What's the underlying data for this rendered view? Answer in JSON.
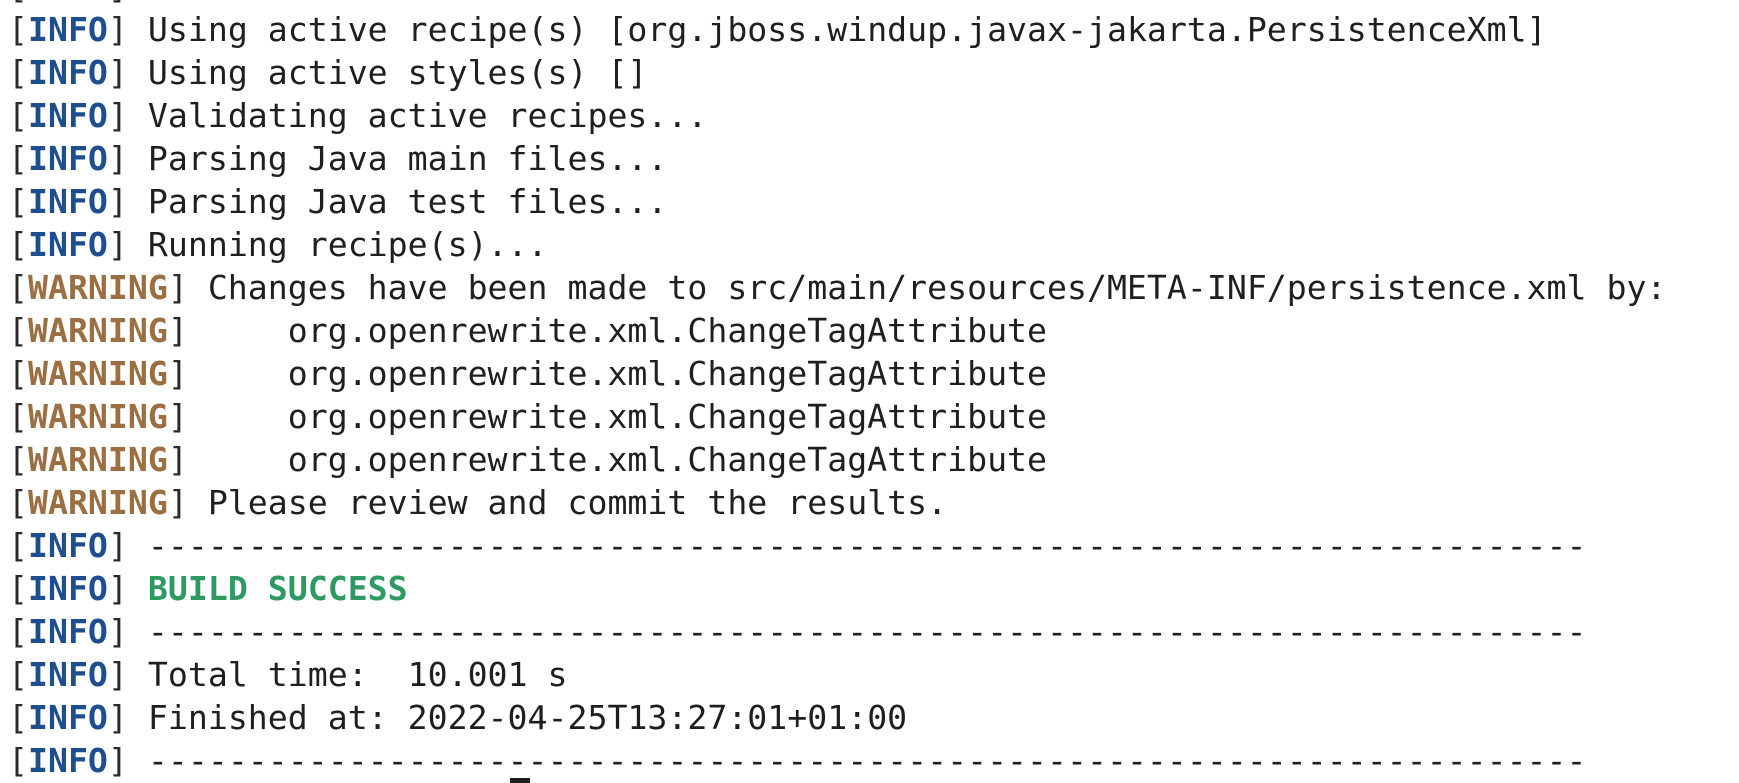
{
  "terminal": {
    "lines": [
      {
        "level": "INFO",
        "text": "Using active recipe(s) [org.jboss.windup.javax-jakarta.PersistenceXml]"
      },
      {
        "level": "INFO",
        "text": "Using active styles(s) []"
      },
      {
        "level": "INFO",
        "text": "Validating active recipes..."
      },
      {
        "level": "INFO",
        "text": "Parsing Java main files..."
      },
      {
        "level": "INFO",
        "text": "Parsing Java test files..."
      },
      {
        "level": "INFO",
        "text": "Running recipe(s)..."
      },
      {
        "level": "WARNING",
        "text": "Changes have been made to src/main/resources/META-INF/persistence.xml by:"
      },
      {
        "level": "WARNING",
        "text": "    org.openrewrite.xml.ChangeTagAttribute"
      },
      {
        "level": "WARNING",
        "text": "    org.openrewrite.xml.ChangeTagAttribute"
      },
      {
        "level": "WARNING",
        "text": "    org.openrewrite.xml.ChangeTagAttribute"
      },
      {
        "level": "WARNING",
        "text": "    org.openrewrite.xml.ChangeTagAttribute"
      },
      {
        "level": "WARNING",
        "text": "Please review and commit the results."
      },
      {
        "level": "INFO",
        "text": "------------------------------------------------------------------------"
      },
      {
        "level": "INFO",
        "text": "BUILD SUCCESS",
        "style": "success"
      },
      {
        "level": "INFO",
        "text": "------------------------------------------------------------------------"
      },
      {
        "level": "INFO",
        "text": "Total time:  10.001 s"
      },
      {
        "level": "INFO",
        "text": "Finished at: 2022-04-25T13:27:01+01:00"
      },
      {
        "level": "INFO",
        "text": "------------------------------------------------------------------------"
      }
    ],
    "colors": {
      "info": "#1d4f8f",
      "warning": "#9c6f43",
      "success": "#2e9a62",
      "background": "#ffffff",
      "text": "#1f1f1f"
    }
  }
}
